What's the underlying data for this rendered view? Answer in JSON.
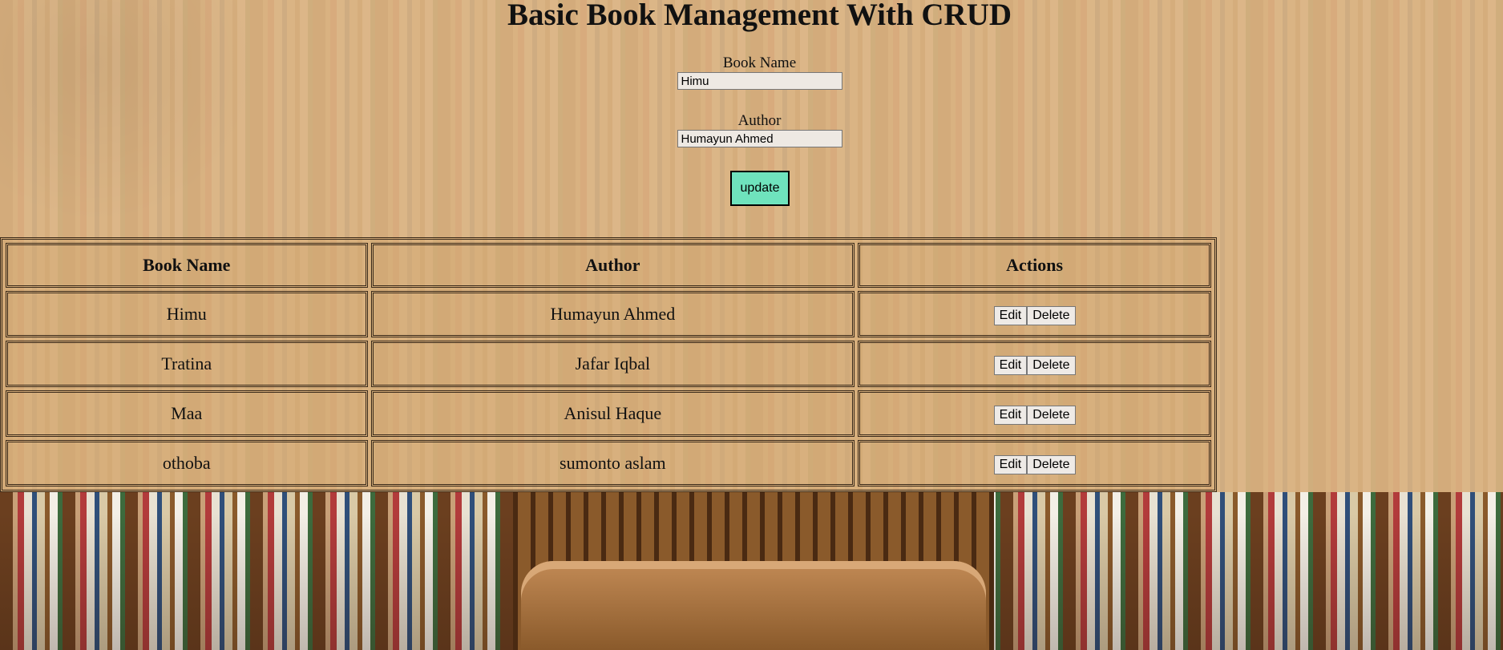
{
  "page": {
    "title": "Basic Book Management With CRUD"
  },
  "form": {
    "book_name_label": "Book Name",
    "book_name_value": "Himu",
    "author_label": "Author",
    "author_value": "Humayun Ahmed",
    "submit_label": "update"
  },
  "table": {
    "headers": [
      "Book Name",
      "Author",
      "Actions"
    ],
    "rows": [
      {
        "book": "Himu",
        "author": "Humayun Ahmed"
      },
      {
        "book": "Tratina",
        "author": "Jafar Iqbal"
      },
      {
        "book": "Maa",
        "author": "Anisul Haque"
      },
      {
        "book": "othoba",
        "author": "sumonto aslam"
      }
    ],
    "edit_label": "Edit",
    "delete_label": "Delete"
  },
  "colors": {
    "update_button": "#6fe3bd",
    "overlay": "#dab282"
  }
}
